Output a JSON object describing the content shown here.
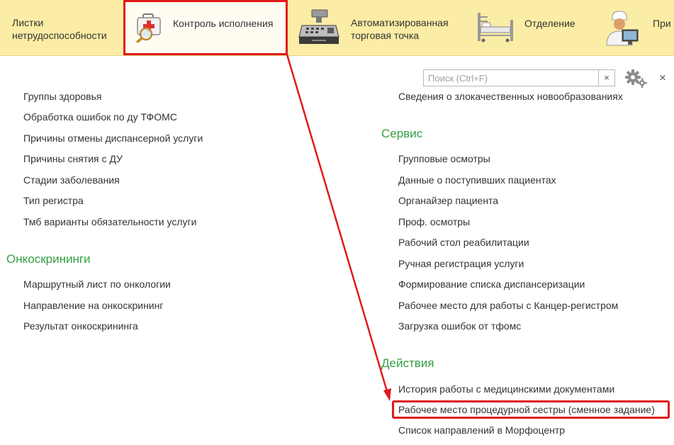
{
  "sections": [
    {
      "label_line1": "Листки",
      "label_line2": "нетрудоспособности",
      "icon": "sick-leave-icon"
    },
    {
      "label_line1": "Контроль исполнения",
      "icon": "first-aid-kit-magnifier-icon",
      "active": true
    },
    {
      "label_line1": "Автоматизированная",
      "label_line2": "торговая точка",
      "icon": "cash-register-icon"
    },
    {
      "label_line1": "Отделение",
      "icon": "hospital-bed-icon"
    },
    {
      "label_line1": "При",
      "icon": "doctor-icon"
    }
  ],
  "search": {
    "placeholder": "Поиск (Ctrl+F)",
    "clear_label": "×"
  },
  "close_label": "×",
  "left_column": {
    "items": [
      "Группы здоровья",
      "Обработка ошибок по ду ТФОМС",
      "Причины отмены диспансерной услуги",
      "Причины снятия с ДУ",
      "Стадии заболевания",
      "Тип регистра",
      "Тмб варианты обязательности услуги"
    ],
    "group_onco": {
      "title": "Онкоскрининги",
      "items": [
        "Маршрутный лист по онкологии",
        "Направление на онкоскрининг",
        "Результат онкоскрининга"
      ]
    }
  },
  "right_column": {
    "top_item": "Сведения о злокачественных новообразованиях",
    "group_service": {
      "title": "Сервис",
      "items": [
        "Групповые осмотры",
        "Данные о поступивших пациентах",
        "Органайзер пациента",
        "Проф. осмотры",
        "Рабочий стол реабилитации",
        "Ручная регистрация услуги",
        "Формирование списка диспансеризации",
        "Рабочее место для работы с Канцер-регистром",
        "Загрузка ошибок от тфомс"
      ]
    },
    "group_actions": {
      "title": "Действия",
      "items": [
        "История работы с медицинскими документами",
        "Рабочее место процедурной сестры (сменное задание)",
        "Список направлений в Морфоцентр"
      ]
    }
  },
  "colors": {
    "section_bar": "#fbeda5",
    "group_title": "#34a043",
    "annotation": "#e01a1a"
  }
}
